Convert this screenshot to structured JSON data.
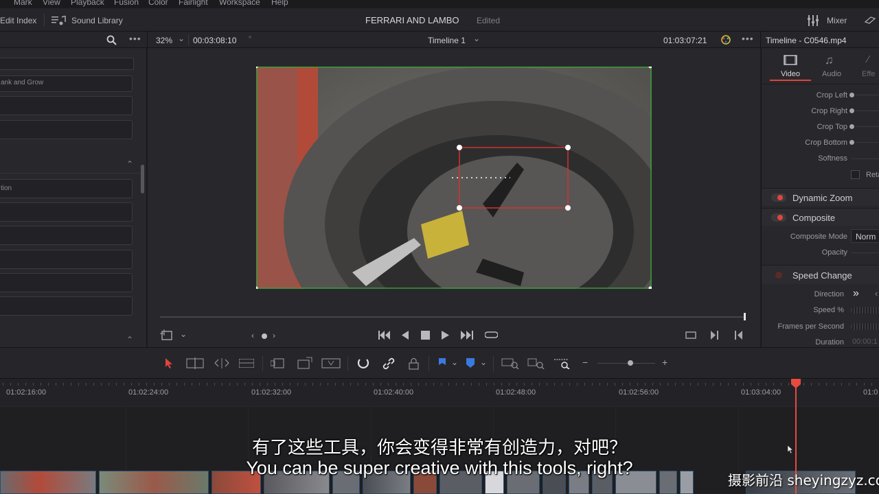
{
  "menu": [
    "Mark",
    "View",
    "Playback",
    "Fusion",
    "Color",
    "Fairlight",
    "Workspace",
    "Help"
  ],
  "toolbar": {
    "edit_index": "Edit Index",
    "sound_library": "Sound Library",
    "project_title": "FERRARI AND LAMBO",
    "edited": "Edited",
    "mixer": "Mixer"
  },
  "viewer": {
    "zoom": "32%",
    "duration": "00:03:08:10",
    "timeline_name": "Timeline 1",
    "timecode": "01:03:07:21"
  },
  "left_panel": {
    "item_text_1": "ank and Grow",
    "item_text_2": "tion"
  },
  "inspector": {
    "title": "Timeline - C0546.mp4",
    "tabs": [
      {
        "label": "Video"
      },
      {
        "label": "Audio"
      },
      {
        "label": "Effe"
      }
    ],
    "crop": [
      "Crop Left",
      "Crop Right",
      "Crop Top",
      "Crop Bottom",
      "Softness"
    ],
    "retain": "Reta",
    "dynamic_zoom": "Dynamic Zoom",
    "composite": "Composite",
    "composite_mode_label": "Composite Mode",
    "composite_mode_value": "Norm",
    "opacity": "Opacity",
    "speed_change": "Speed Change",
    "direction": "Direction",
    "speed_pct": "Speed %",
    "fps": "Frames per Second",
    "duration": "Duration",
    "duration_value": "00:00:1"
  },
  "ruler": {
    "timecodes": [
      "01:02:16:00",
      "01:02:24:00",
      "01:02:32:00",
      "01:02:40:00",
      "01:02:48:00",
      "01:02:56:00",
      "01:03:04:00",
      "01:0"
    ]
  },
  "subtitles": {
    "chinese": "有了这些工具，你会变得非常有创造力，对吧？",
    "english": "You can be super creative with this tools, right?"
  },
  "watermark": "摄影前沿 sheyingzyz.com",
  "colors": {
    "accent_red": "#e0443c",
    "playhead": "#e64a40",
    "clip_border": "#2c4d6a"
  }
}
